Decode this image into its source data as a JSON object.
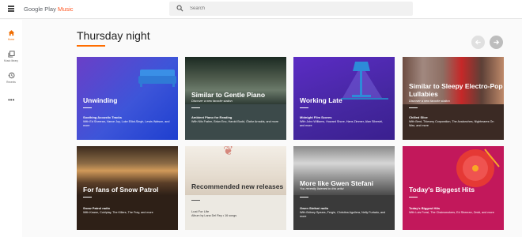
{
  "app": {
    "logo_prefix": "Google Play ",
    "logo_accent": "Music",
    "accent_color": "#ff5722"
  },
  "search": {
    "placeholder": "Search",
    "value": ""
  },
  "sidebar": {
    "items": [
      {
        "label": "Home",
        "icon": "home-icon",
        "active": true
      },
      {
        "label": "Music library",
        "icon": "library-icon",
        "active": false
      },
      {
        "label": "Recents",
        "icon": "recents-icon",
        "active": false
      }
    ],
    "more_icon": "more-icon"
  },
  "section": {
    "title": "Thursday night"
  },
  "cards": [
    {
      "title": "Unwinding",
      "subtitle": "",
      "station": "Soothing Acoustic Tracks",
      "description": "With Ed Sheeran, Vance Joy, Luke Elliot-Singh, Lewis Watson, and more",
      "bg": "#3949ab"
    },
    {
      "title": "Similar to Gentle Piano",
      "subtitle": "Discover a new favorite station",
      "station": "Ambient Piano for Reading",
      "description": "With Nils Frahm, Brian Eno, Harold Budd, Ólafur Arnalds, and more",
      "bg": "#37474f"
    },
    {
      "title": "Working Late",
      "subtitle": "",
      "station": "Midnight Film Scores",
      "description": "With John Williams, Howard Shore, Hans Zimmer, Alan Silvestri, and more",
      "bg": "#4527a0"
    },
    {
      "title": "Similar to Sleepy Electro-Pop Lullabies",
      "subtitle": "Discover a new favorite station",
      "station": "Chilled Slice",
      "description": "With Bent, Thievery Corporation, The Avalanches, Nightmares On Wax, and more",
      "bg": "#3e2723"
    },
    {
      "title": "For fans of Snow Patrol",
      "subtitle": "",
      "station": "Snow Patrol radio",
      "description": "With Keane, Coldplay, The Killers, The Fray, and more",
      "bg": "#4e342e"
    },
    {
      "title": "Recommended new releases",
      "subtitle": "",
      "station": "Lust For Life",
      "description": "Album by Lana Del Rey • 16 songs",
      "bg": "#ece9e2"
    },
    {
      "title": "More like Gwen Stefani",
      "subtitle": "You recently listened to this artist",
      "station": "Gwen Stefani radio",
      "description": "With Britney Spears, Fergie, Christina Aguilera, Nelly Furtado, and more",
      "bg": "#424242"
    },
    {
      "title": "Today's Biggest Hits",
      "subtitle": "",
      "station": "Today's Biggest Hits",
      "description": "With Luis Fonsi, The Chainsmokers, Ed Sheeran, Zedd, and more",
      "bg": "#c2185b"
    }
  ]
}
